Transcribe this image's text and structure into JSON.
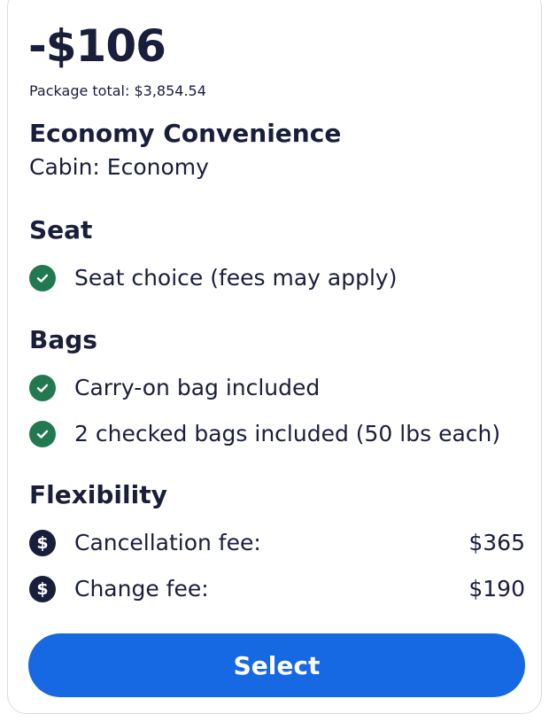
{
  "price": "-$106",
  "package_total": "Package total: $3,854.54",
  "fare_name": "Economy Convenience",
  "cabin": "Cabin: Economy",
  "seat": {
    "title": "Seat",
    "items": [
      {
        "icon": "check-circle-icon",
        "label": "Seat choice (fees may apply)"
      }
    ]
  },
  "bags": {
    "title": "Bags",
    "items": [
      {
        "icon": "check-circle-icon",
        "label": "Carry-on bag included"
      },
      {
        "icon": "check-circle-icon",
        "label": "2 checked bags included (50 lbs each)"
      }
    ]
  },
  "flexibility": {
    "title": "Flexibility",
    "items": [
      {
        "icon": "dollar-circle-icon",
        "label": "Cancellation fee:",
        "value": "$365"
      },
      {
        "icon": "dollar-circle-icon",
        "label": "Change fee:",
        "value": "$190"
      }
    ]
  },
  "select_label": "Select",
  "colors": {
    "text": "#191e3b",
    "check_green": "#227950",
    "button_blue": "#1668e3",
    "border": "#dcdcdc"
  }
}
